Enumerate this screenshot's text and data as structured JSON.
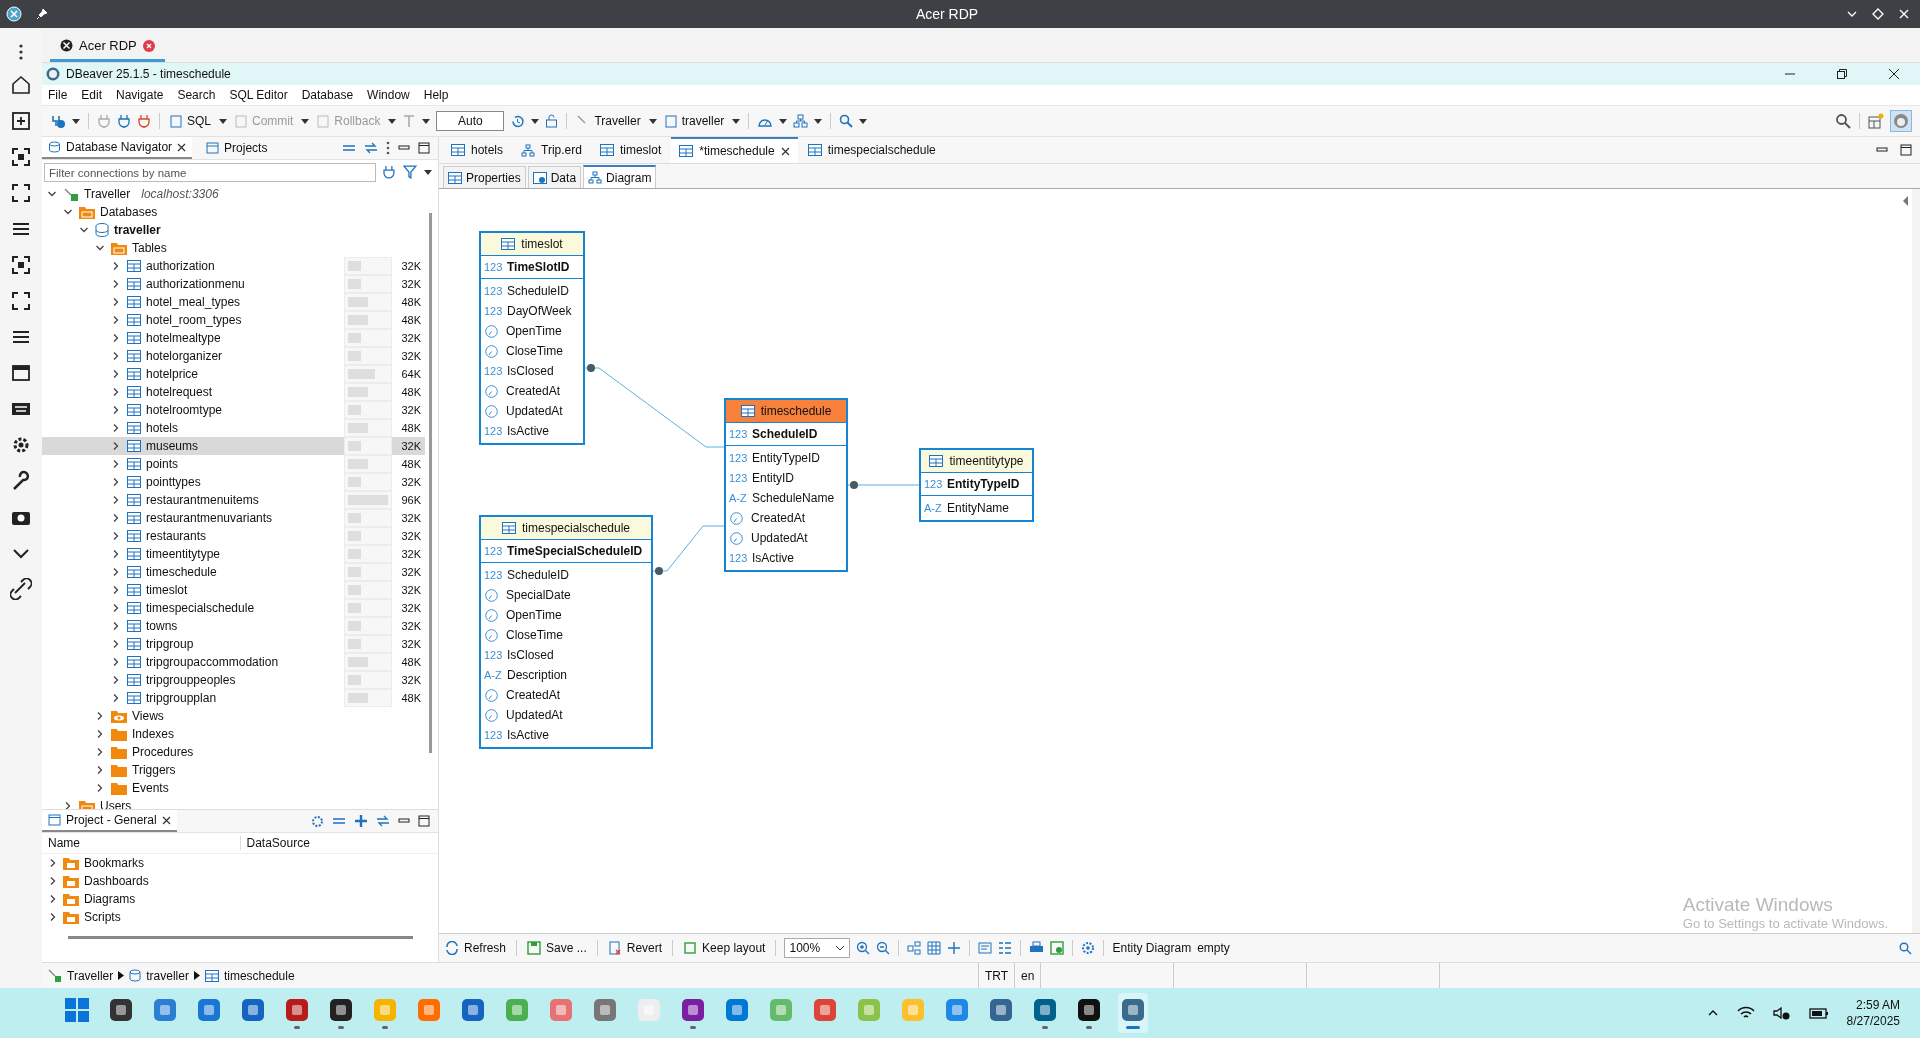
{
  "rdp": {
    "title": "Acer RDP",
    "tab": "Acer RDP"
  },
  "window": {
    "title": "DBeaver 25.1.5 - timeschedule"
  },
  "menu": [
    "File",
    "Edit",
    "Navigate",
    "Search",
    "SQL Editor",
    "Database",
    "Window",
    "Help"
  ],
  "toolbar": {
    "buttons": [
      {
        "label": "SQL",
        "disabled": false
      },
      {
        "label": "Commit",
        "disabled": true
      },
      {
        "label": "Rollback",
        "disabled": true
      }
    ],
    "transaction_mode": "Auto",
    "connection": "Traveller",
    "schema": "traveller"
  },
  "navigator": {
    "tabs": [
      {
        "label": "Database Navigator",
        "selected": true
      },
      {
        "label": "Projects",
        "selected": false
      }
    ],
    "filter_placeholder": "Filter connections by name",
    "tree": [
      {
        "kind": "connection",
        "label": "Traveller",
        "detail": "localhost:3306",
        "expanded": true,
        "selected": false,
        "children": [
          {
            "kind": "databases",
            "label": "Databases",
            "expanded": true,
            "selected": false,
            "children": [
              {
                "kind": "database",
                "label": "traveller",
                "expanded": true,
                "selected": false,
                "children": [
                  {
                    "kind": "tables",
                    "label": "Tables",
                    "expanded": true,
                    "selected": false,
                    "children": [
                      {
                        "kind": "table",
                        "label": "authorization",
                        "expanded": false,
                        "selected": false,
                        "size": "32K",
                        "level": 0.33
                      },
                      {
                        "kind": "table",
                        "label": "authorizationmenu",
                        "expanded": false,
                        "selected": false,
                        "size": "32K",
                        "level": 0.33
                      },
                      {
                        "kind": "table",
                        "label": "hotel_meal_types",
                        "expanded": false,
                        "selected": false,
                        "size": "48K",
                        "level": 0.5
                      },
                      {
                        "kind": "table",
                        "label": "hotel_room_types",
                        "expanded": false,
                        "selected": false,
                        "size": "48K",
                        "level": 0.5
                      },
                      {
                        "kind": "table",
                        "label": "hotelmealtype",
                        "expanded": false,
                        "selected": false,
                        "size": "32K",
                        "level": 0.33
                      },
                      {
                        "kind": "table",
                        "label": "hotelorganizer",
                        "expanded": false,
                        "selected": false,
                        "size": "32K",
                        "level": 0.33
                      },
                      {
                        "kind": "table",
                        "label": "hotelprice",
                        "expanded": false,
                        "selected": false,
                        "size": "64K",
                        "level": 0.67
                      },
                      {
                        "kind": "table",
                        "label": "hotelrequest",
                        "expanded": false,
                        "selected": false,
                        "size": "48K",
                        "level": 0.5
                      },
                      {
                        "kind": "table",
                        "label": "hotelroomtype",
                        "expanded": false,
                        "selected": false,
                        "size": "32K",
                        "level": 0.33
                      },
                      {
                        "kind": "table",
                        "label": "hotels",
                        "expanded": false,
                        "selected": false,
                        "size": "48K",
                        "level": 0.5
                      },
                      {
                        "kind": "table",
                        "label": "museums",
                        "expanded": false,
                        "selected": true,
                        "size": "32K",
                        "level": 0.33
                      },
                      {
                        "kind": "table",
                        "label": "points",
                        "expanded": false,
                        "selected": false,
                        "size": "48K",
                        "level": 0.5
                      },
                      {
                        "kind": "table",
                        "label": "pointtypes",
                        "expanded": false,
                        "selected": false,
                        "size": "32K",
                        "level": 0.33
                      },
                      {
                        "kind": "table",
                        "label": "restaurantmenuitems",
                        "expanded": false,
                        "selected": false,
                        "size": "96K",
                        "level": 1
                      },
                      {
                        "kind": "table",
                        "label": "restaurantmenuvariants",
                        "expanded": false,
                        "selected": false,
                        "size": "32K",
                        "level": 0.33
                      },
                      {
                        "kind": "table",
                        "label": "restaurants",
                        "expanded": false,
                        "selected": false,
                        "size": "32K",
                        "level": 0.33
                      },
                      {
                        "kind": "table",
                        "label": "timeentitytype",
                        "expanded": false,
                        "selected": false,
                        "size": "32K",
                        "level": 0.33
                      },
                      {
                        "kind": "table",
                        "label": "timeschedule",
                        "expanded": false,
                        "selected": false,
                        "size": "32K",
                        "level": 0.33
                      },
                      {
                        "kind": "table",
                        "label": "timeslot",
                        "expanded": false,
                        "selected": false,
                        "size": "32K",
                        "level": 0.33
                      },
                      {
                        "kind": "table",
                        "label": "timespecialschedule",
                        "expanded": false,
                        "selected": false,
                        "size": "32K",
                        "level": 0.33
                      },
                      {
                        "kind": "table",
                        "label": "towns",
                        "expanded": false,
                        "selected": false,
                        "size": "32K",
                        "level": 0.33
                      },
                      {
                        "kind": "table",
                        "label": "tripgroup",
                        "expanded": false,
                        "selected": false,
                        "size": "32K",
                        "level": 0.33
                      },
                      {
                        "kind": "table",
                        "label": "tripgroupaccommodation",
                        "expanded": false,
                        "selected": false,
                        "size": "48K",
                        "level": 0.5
                      },
                      {
                        "kind": "table",
                        "label": "tripgrouppeoples",
                        "expanded": false,
                        "selected": false,
                        "size": "32K",
                        "level": 0.33
                      },
                      {
                        "kind": "table",
                        "label": "tripgroupplan",
                        "expanded": false,
                        "selected": false,
                        "size": "48K",
                        "level": 0.5
                      }
                    ]
                  },
                  {
                    "kind": "views",
                    "label": "Views",
                    "expanded": false,
                    "selected": false
                  },
                  {
                    "kind": "folder",
                    "label": "Indexes",
                    "expanded": false,
                    "selected": false
                  },
                  {
                    "kind": "folder",
                    "label": "Procedures",
                    "expanded": false,
                    "selected": false
                  },
                  {
                    "kind": "folder",
                    "label": "Triggers",
                    "expanded": false,
                    "selected": false
                  },
                  {
                    "kind": "folder",
                    "label": "Events",
                    "expanded": false,
                    "selected": false
                  }
                ]
              }
            ]
          },
          {
            "kind": "databases",
            "label": "Users",
            "expanded": false,
            "selected": false
          }
        ]
      }
    ]
  },
  "project": {
    "tab": "Project - General",
    "columns": [
      "Name",
      "DataSource"
    ],
    "rows": [
      {
        "label": "Bookmarks",
        "expanded": false
      },
      {
        "label": "Dashboards",
        "expanded": false
      },
      {
        "label": "Diagrams",
        "expanded": false
      },
      {
        "label": "Scripts",
        "expanded": false
      }
    ]
  },
  "editor_tabs": [
    {
      "kind": "table",
      "label": "hotels",
      "selected": false
    },
    {
      "kind": "erd",
      "label": "Trip.erd",
      "selected": false
    },
    {
      "kind": "table",
      "label": "timeslot",
      "selected": false
    },
    {
      "kind": "table",
      "label": "*timeschedule",
      "selected": true
    },
    {
      "kind": "table",
      "label": "timespecialschedule",
      "selected": false
    }
  ],
  "sub_tabs": [
    {
      "kind": "properties",
      "label": "Properties",
      "selected": false
    },
    {
      "kind": "data",
      "label": "Data",
      "selected": false
    },
    {
      "kind": "diagram",
      "label": "Diagram",
      "selected": true
    }
  ],
  "diagram": {
    "entities": [
      {
        "name": "timeslot",
        "selected": false,
        "key": {
          "kind": "number",
          "type_label": "123",
          "name": "TimeSlotID"
        },
        "columns": [
          {
            "kind": "number",
            "type_label": "123",
            "name": "ScheduleID"
          },
          {
            "kind": "number",
            "type_label": "123",
            "name": "DayOfWeek"
          },
          {
            "kind": "time",
            "name": "OpenTime"
          },
          {
            "kind": "time",
            "name": "CloseTime"
          },
          {
            "kind": "number",
            "type_label": "123",
            "name": "IsClosed"
          },
          {
            "kind": "time",
            "name": "CreatedAt"
          },
          {
            "kind": "time",
            "name": "UpdatedAt"
          },
          {
            "kind": "number",
            "type_label": "123",
            "name": "IsActive"
          }
        ]
      },
      {
        "name": "timeschedule",
        "selected": true,
        "key": {
          "kind": "number",
          "type_label": "123",
          "name": "ScheduleID"
        },
        "columns": [
          {
            "kind": "number",
            "type_label": "123",
            "name": "EntityTypeID"
          },
          {
            "kind": "number",
            "type_label": "123",
            "name": "EntityID"
          },
          {
            "kind": "text",
            "type_label": "A-Z",
            "name": "ScheduleName"
          },
          {
            "kind": "time",
            "name": "CreatedAt"
          },
          {
            "kind": "time",
            "name": "UpdatedAt"
          },
          {
            "kind": "number",
            "type_label": "123",
            "name": "IsActive"
          }
        ]
      },
      {
        "name": "timeentitytype",
        "selected": false,
        "key": {
          "kind": "number",
          "type_label": "123",
          "name": "EntityTypeID"
        },
        "columns": [
          {
            "kind": "text",
            "type_label": "A-Z",
            "name": "EntityName"
          }
        ]
      },
      {
        "name": "timespecialschedule",
        "selected": false,
        "key": {
          "kind": "number",
          "type_label": "123",
          "name": "TimeSpecialScheduleID"
        },
        "columns": [
          {
            "kind": "number",
            "type_label": "123",
            "name": "ScheduleID"
          },
          {
            "kind": "time",
            "name": "SpecialDate"
          },
          {
            "kind": "time",
            "name": "OpenTime"
          },
          {
            "kind": "time",
            "name": "CloseTime"
          },
          {
            "kind": "number",
            "type_label": "123",
            "name": "IsClosed"
          },
          {
            "kind": "text",
            "type_label": "A-Z",
            "name": "Description"
          },
          {
            "kind": "time",
            "name": "CreatedAt"
          },
          {
            "kind": "time",
            "name": "UpdatedAt"
          },
          {
            "kind": "number",
            "type_label": "123",
            "name": "IsActive"
          }
        ]
      }
    ]
  },
  "diagram_toolbar": {
    "buttons": [
      "Refresh",
      "Save ...",
      "Revert",
      "Keep layout"
    ],
    "zoom": "100%",
    "status": "Entity Diagram",
    "status_detail": "empty"
  },
  "activation_notice": {
    "title": "Activate Windows",
    "text": "Go to Settings to activate Windows."
  },
  "status_bar": {
    "breadcrumb": [
      "Traveller",
      "traveller",
      "timeschedule"
    ],
    "timezone": "TRT",
    "locale": "en"
  },
  "taskbar": {
    "apps": [
      {
        "running": false,
        "selected": false
      },
      {
        "running": false,
        "selected": false
      },
      {
        "running": false,
        "selected": false
      },
      {
        "running": false,
        "selected": false
      },
      {
        "running": false,
        "selected": false
      },
      {
        "running": true,
        "selected": false
      },
      {
        "running": true,
        "selected": false
      },
      {
        "running": true,
        "selected": false
      },
      {
        "running": false,
        "selected": false
      },
      {
        "running": false,
        "selected": false
      },
      {
        "running": false,
        "selected": false
      },
      {
        "running": false,
        "selected": false
      },
      {
        "running": false,
        "selected": false
      },
      {
        "running": false,
        "selected": false
      },
      {
        "running": true,
        "selected": false
      },
      {
        "running": false,
        "selected": false
      },
      {
        "running": false,
        "selected": false
      },
      {
        "running": false,
        "selected": false
      },
      {
        "running": false,
        "selected": false
      },
      {
        "running": false,
        "selected": false
      },
      {
        "running": false,
        "selected": false
      },
      {
        "running": false,
        "selected": false
      },
      {
        "running": true,
        "selected": false
      },
      {
        "running": true,
        "selected": false
      },
      {
        "running": true,
        "selected": true
      }
    ],
    "time": "2:59 AM",
    "date": "8/27/2025"
  }
}
